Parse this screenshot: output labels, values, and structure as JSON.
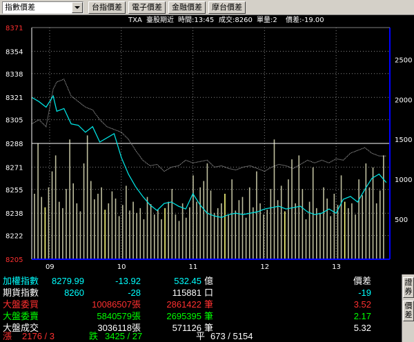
{
  "toolbar": {
    "selector_value": "指數價差",
    "buttons": [
      "台指價差",
      "電子價差",
      "金融價差",
      "摩台價差"
    ]
  },
  "chart_header": {
    "symbol": "TXA",
    "contract": "臺股期近",
    "time_label": "時間:13:45",
    "volume_label": "成交:8260",
    "unit_label": "單量:2",
    "spread_label": "價差:-19.00"
  },
  "chart_data": {
    "type": "line",
    "y_ticks_price": [
      8205,
      8222,
      8238,
      8255,
      8271,
      8288,
      8305,
      8321,
      8338,
      8354,
      8371
    ],
    "y_ticks_volume": [
      500,
      1000,
      1500,
      2000,
      2500
    ],
    "x_ticks": [
      "09",
      "10",
      "11",
      "12",
      "13"
    ],
    "ylim_price": [
      8205,
      8371
    ],
    "ylim_volume": [
      0,
      2900
    ],
    "x_range_hours": [
      8.75,
      13.75
    ],
    "reference_price": 8288,
    "series": [
      {
        "x": [
          8.75,
          8.85,
          8.95,
          9.05,
          9.1,
          9.2,
          9.3,
          9.4,
          9.5,
          9.6,
          9.7,
          9.8,
          9.9,
          10.0,
          10.1,
          10.2,
          10.3,
          10.4,
          10.5,
          10.6,
          10.7,
          10.8,
          10.9,
          11.0,
          11.1,
          11.2,
          11.3,
          11.4,
          11.5,
          11.6,
          11.7,
          11.8,
          11.9,
          12.0,
          12.1,
          12.2,
          12.3,
          12.4,
          12.5,
          12.6,
          12.7,
          12.8,
          12.9,
          13.0,
          13.1,
          13.2,
          13.3,
          13.4,
          13.5,
          13.6,
          13.7
        ],
        "values": [
          8302,
          8305,
          8300,
          8327,
          8332,
          8334,
          8322,
          8318,
          8314,
          8312,
          8305,
          8300,
          8298,
          8296,
          8291,
          8283,
          8276,
          8272,
          8273,
          8268,
          8271,
          8272,
          8276,
          8274,
          8275,
          8276,
          8271,
          8272,
          8270,
          8269,
          8271,
          8272,
          8270,
          8268,
          8271,
          8273,
          8272,
          8270,
          8273,
          8276,
          8274,
          8276,
          8274,
          8277,
          8276,
          8281,
          8283,
          8285,
          8281,
          8279,
          8279
        ]
      },
      {
        "x": [
          8.75,
          8.85,
          8.95,
          9.05,
          9.1,
          9.2,
          9.3,
          9.4,
          9.5,
          9.6,
          9.7,
          9.8,
          9.9,
          10.0,
          10.1,
          10.2,
          10.3,
          10.4,
          10.5,
          10.6,
          10.7,
          10.8,
          10.9,
          11.0,
          11.1,
          11.2,
          11.3,
          11.4,
          11.5,
          11.6,
          11.7,
          11.8,
          11.9,
          12.0,
          12.1,
          12.2,
          12.3,
          12.4,
          12.5,
          12.6,
          12.7,
          12.8,
          12.9,
          13.0,
          13.1,
          13.2,
          13.3,
          13.4,
          13.5,
          13.6,
          13.7
        ],
        "values": [
          8321,
          8318,
          8314,
          8322,
          8311,
          8313,
          8302,
          8301,
          8296,
          8300,
          8289,
          8292,
          8295,
          8278,
          8266,
          8257,
          8250,
          8244,
          8240,
          8245,
          8246,
          8243,
          8241,
          8252,
          8244,
          8238,
          8236,
          8235,
          8237,
          8238,
          8237,
          8238,
          8239,
          8241,
          8242,
          8243,
          8241,
          8242,
          8243,
          8239,
          8237,
          8238,
          8241,
          8238,
          8248,
          8250,
          8246,
          8255,
          8263,
          8266,
          8260
        ]
      }
    ],
    "volume": [
      820,
      1450,
      780,
      650,
      900,
      1100,
      1300,
      720,
      640,
      880,
      1500,
      950,
      700,
      600,
      1200,
      1550,
      980,
      750,
      820,
      900,
      620,
      700,
      850,
      760,
      540,
      680,
      920,
      610,
      720,
      580,
      640,
      500,
      780,
      690,
      560,
      620,
      500,
      640,
      720,
      880,
      560,
      480,
      700,
      520,
      650,
      1050,
      720,
      900,
      980,
      1200,
      860,
      580,
      640,
      700,
      820,
      560,
      1000,
      610,
      740,
      780,
      520,
      900,
      650,
      1100,
      700,
      560,
      620,
      880,
      1500,
      740,
      920,
      600,
      1000,
      1250,
      700,
      1300,
      880,
      500,
      720,
      1150,
      640,
      580,
      900,
      760,
      540,
      820,
      680,
      1050,
      720,
      640,
      700,
      560,
      1000,
      800,
      1200,
      900,
      1150,
      700,
      860,
      1300
    ]
  },
  "quotes": {
    "rows": [
      {
        "name": "加權指數",
        "v1": "8279.99",
        "v2": "-13.92",
        "v3": "532.45",
        "u3": "億",
        "v4": "價差"
      },
      {
        "name": "期貨指數",
        "v1": "8260",
        "v2": "-28",
        "v3": "115881",
        "u3": "口",
        "v4": "-19"
      },
      {
        "name": "大盤委買",
        "v1": "10086507張",
        "v3": "2861422",
        "u3": "筆",
        "v4": "3.52"
      },
      {
        "name": "大盤委賣",
        "v1": "5840579張",
        "v3": "2695395",
        "u3": "筆",
        "v4": "2.17"
      },
      {
        "name": "大盤成交",
        "v1": "3036118張",
        "v3": "571126",
        "u3": "筆",
        "v4": "5.32"
      }
    ],
    "breadth": {
      "up_label": "漲",
      "up_value": "2176 / 3",
      "down_label": "跌",
      "down_value": "3425 / 27",
      "flat_label": "平",
      "flat_value": "673 / 5154"
    }
  },
  "side_tabs": [
    "證券",
    "價差"
  ],
  "colors": {
    "price_line": "#00e0e0",
    "spot_line": "#c0c0c0",
    "volume_bar": "#bfbf9f",
    "volume_highlight": "#ffff80",
    "axis_blue": "#0000ff",
    "up": "#ff3030",
    "down": "#00ff00"
  }
}
